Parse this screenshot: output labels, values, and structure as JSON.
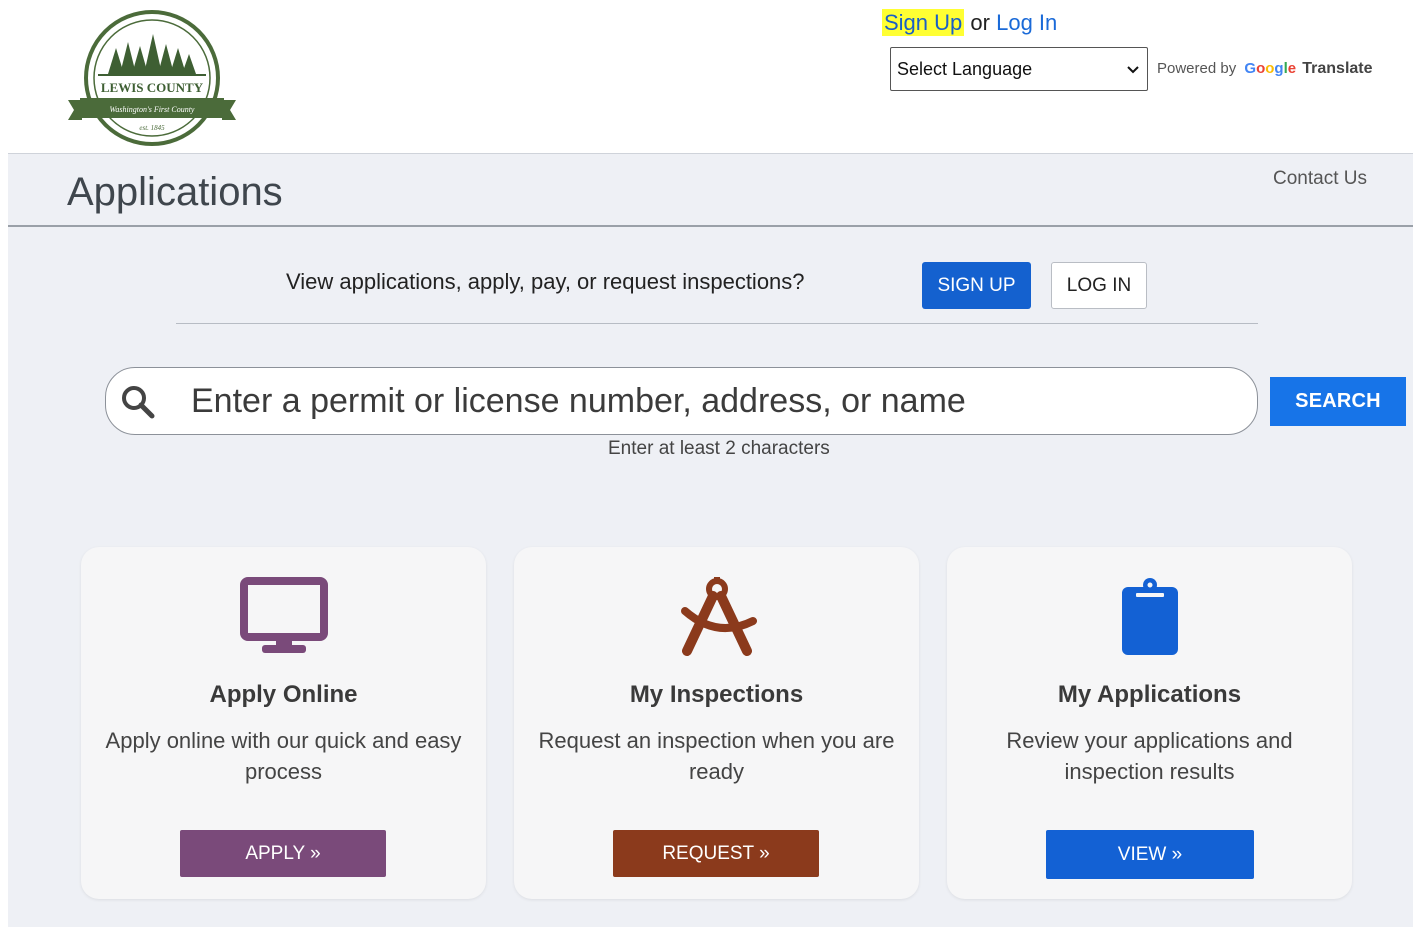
{
  "header": {
    "logo": {
      "name": "LEWIS COUNTY",
      "tagline": "Washington's First County",
      "est": "est. 1845"
    },
    "signup_link": "Sign Up",
    "or_text": "or",
    "login_link": "Log In",
    "language_select": "Select Language",
    "powered_by": "Powered by",
    "google": "Google",
    "translate": "Translate"
  },
  "title_bar": {
    "title": "Applications",
    "contact": "Contact Us"
  },
  "prompt": {
    "text": "View applications, apply, pay, or request inspections?",
    "signup_button": "SIGN UP",
    "login_button": "LOG IN"
  },
  "search": {
    "placeholder": "Enter a permit or license number, address, or name",
    "button": "SEARCH",
    "hint": "Enter at least 2 characters"
  },
  "cards": [
    {
      "title": "Apply Online",
      "description": "Apply online with our quick and easy process",
      "button": "APPLY »",
      "icon": "monitor-icon",
      "color": "#7a4a7a"
    },
    {
      "title": "My Inspections",
      "description": "Request an inspection when you are ready",
      "button": "REQUEST »",
      "icon": "compass-icon",
      "color": "#8b3a1c"
    },
    {
      "title": "My Applications",
      "description": "Review your applications and inspection results",
      "button": "VIEW »",
      "icon": "clipboard-icon",
      "color": "#1361d4"
    }
  ]
}
